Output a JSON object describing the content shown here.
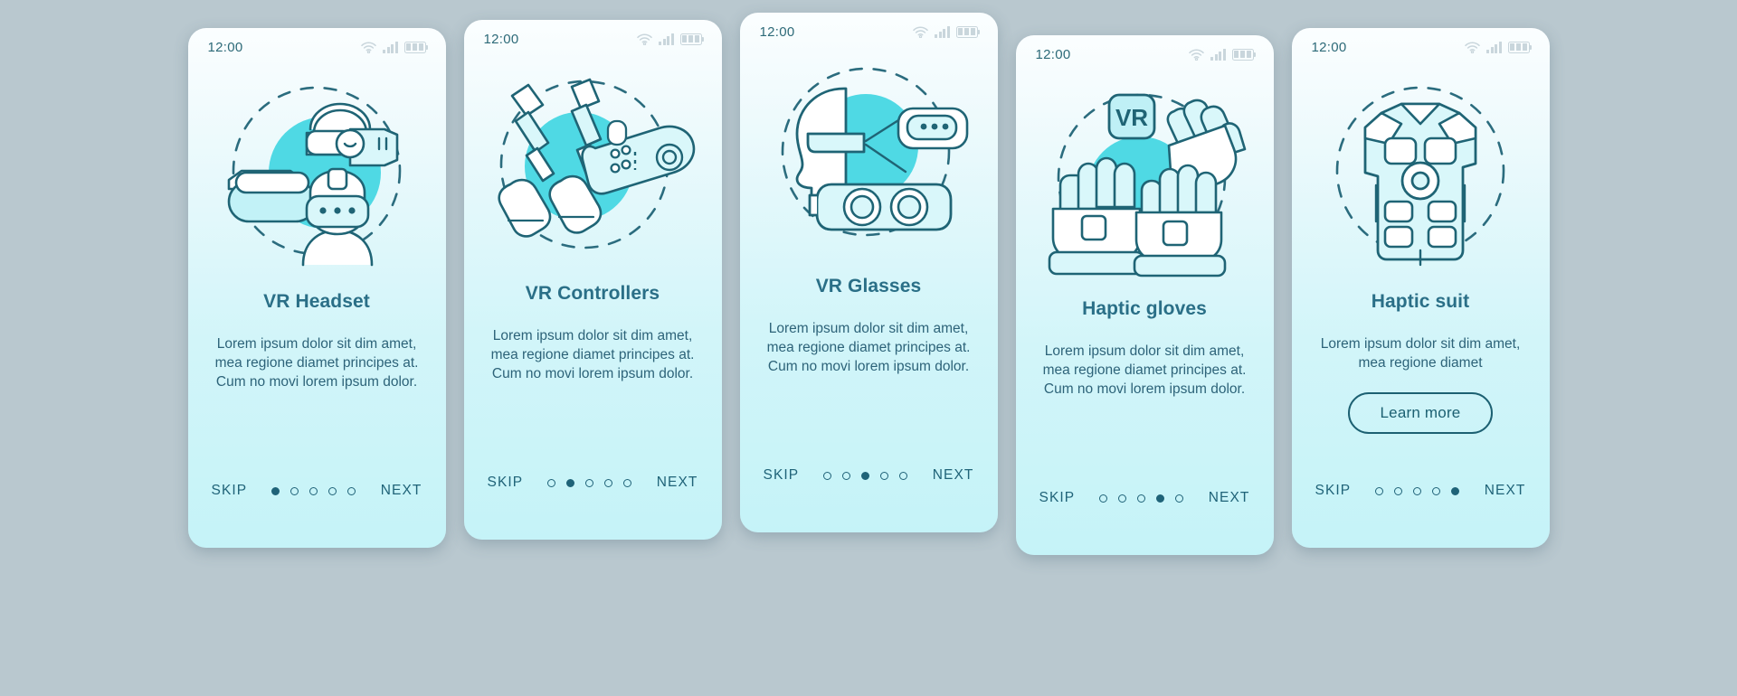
{
  "theme": {
    "page_background": "#b9c8cf",
    "card_background_top": "#fbfeff",
    "card_background_bottom": "#c5f3f8",
    "accent": "#4fd9e4",
    "ink": "#1f6378",
    "title_color": "#2a6f87",
    "body_color": "#2d6379",
    "status_icon_color": "#c9d6dc"
  },
  "status_bar": {
    "time": "12:00",
    "icons": [
      "wifi-icon",
      "signal-icon",
      "battery-icon"
    ]
  },
  "nav": {
    "skip_label": "SKIP",
    "next_label": "NEXT",
    "total_dots": 5
  },
  "screens": [
    {
      "id": "vr-headset",
      "illustration": "vr-headset-illustration",
      "title": "VR Headset",
      "description": "Lorem ipsum dolor sit dim amet, mea regione diamet principes at. Cum no movi lorem ipsum dolor.",
      "active_dot": 1,
      "cta": null
    },
    {
      "id": "vr-controllers",
      "illustration": "vr-controllers-illustration",
      "title": "VR Controllers",
      "description": "Lorem ipsum dolor sit dim amet, mea regione diamet principes at. Cum no movi lorem ipsum dolor.",
      "active_dot": 2,
      "cta": null
    },
    {
      "id": "vr-glasses",
      "illustration": "vr-glasses-illustration",
      "title": "VR Glasses",
      "description": "Lorem ipsum dolor sit dim amet, mea regione diamet principes at. Cum no movi lorem ipsum dolor.",
      "active_dot": 3,
      "cta": null
    },
    {
      "id": "haptic-gloves",
      "illustration": "haptic-gloves-illustration",
      "badge": "VR",
      "title": "Haptic gloves",
      "description": "Lorem ipsum dolor sit dim amet, mea regione diamet principes at. Cum no movi lorem ipsum dolor.",
      "active_dot": 4,
      "cta": null
    },
    {
      "id": "haptic-suit",
      "illustration": "haptic-suit-illustration",
      "title": "Haptic suit",
      "description": "Lorem ipsum dolor sit dim amet, mea regione diamet",
      "active_dot": 5,
      "cta": "Learn more"
    }
  ]
}
